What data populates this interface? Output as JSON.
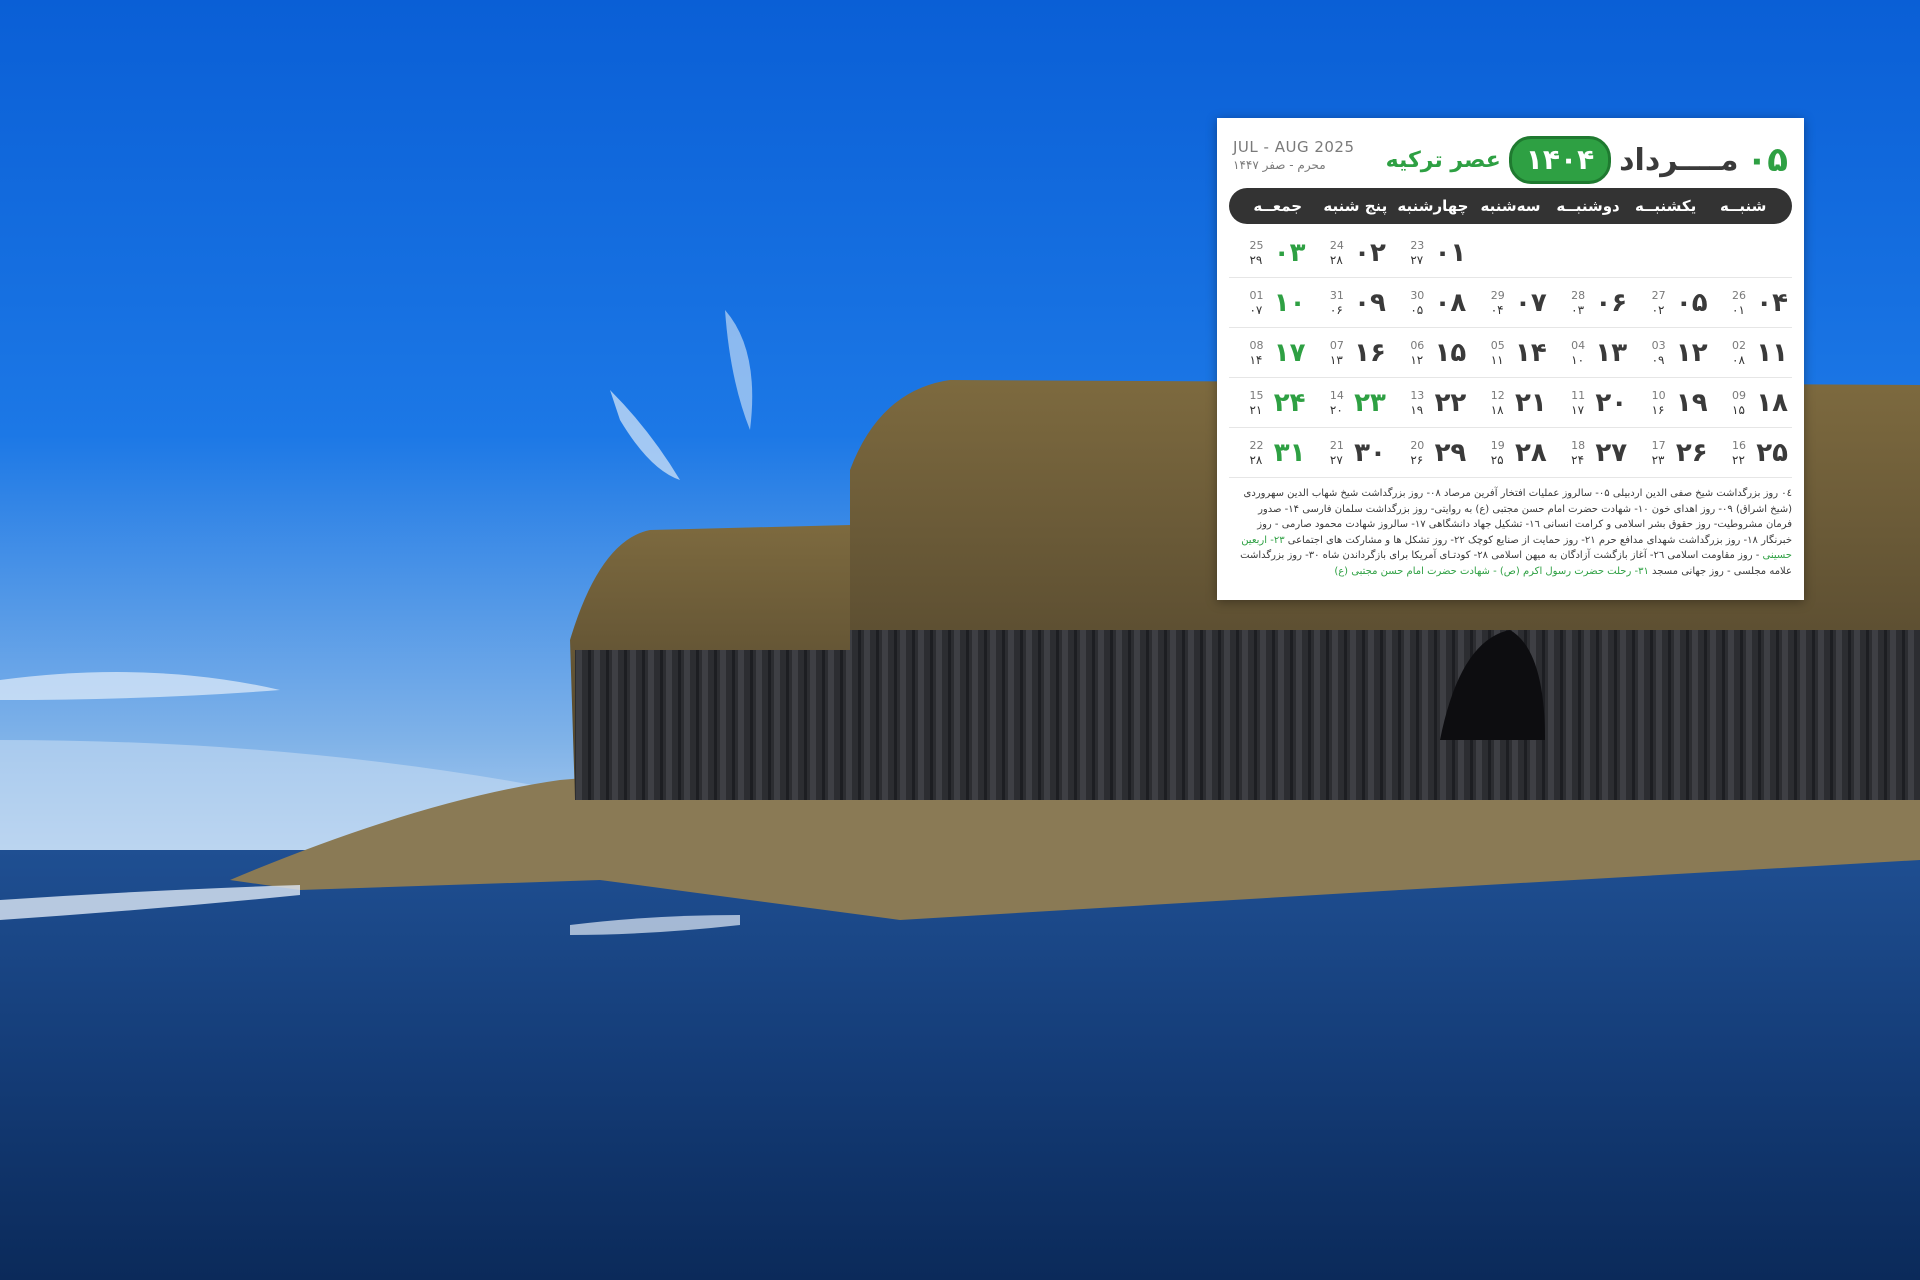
{
  "calendar": {
    "month_number": "۰۵",
    "month_name": "مــــرداد",
    "year": "۱۴۰۴",
    "brand": "عصر ترکیه",
    "gregorian_range": "JUL - AUG 2025",
    "hijri_range": "محرم - صفر ۱۴۴۷",
    "weekdays": [
      "شنبــه",
      "یکشنبــه",
      "دوشنبــه",
      "سه‌شنبه",
      "چهارشنبه",
      "پنج شنبه",
      "جمعــه"
    ],
    "weeks": [
      [
        {
          "day": "",
          "g": "",
          "h": ""
        },
        {
          "day": "",
          "g": "",
          "h": ""
        },
        {
          "day": "",
          "g": "",
          "h": ""
        },
        {
          "day": "",
          "g": "",
          "h": ""
        },
        {
          "day": "۰۱",
          "g": "23",
          "h": "۲۷"
        },
        {
          "day": "۰۲",
          "g": "24",
          "h": "۲۸"
        },
        {
          "day": "۰۳",
          "g": "25",
          "h": "۲۹"
        }
      ],
      [
        {
          "day": "۰۴",
          "g": "26",
          "h": "۰۱"
        },
        {
          "day": "۰۵",
          "g": "27",
          "h": "۰۲"
        },
        {
          "day": "۰۶",
          "g": "28",
          "h": "۰۳"
        },
        {
          "day": "۰۷",
          "g": "29",
          "h": "۰۴"
        },
        {
          "day": "۰۸",
          "g": "30",
          "h": "۰۵"
        },
        {
          "day": "۰۹",
          "g": "31",
          "h": "۰۶"
        },
        {
          "day": "۱۰",
          "g": "01",
          "h": "۰۷"
        }
      ],
      [
        {
          "day": "۱۱",
          "g": "02",
          "h": "۰۸"
        },
        {
          "day": "۱۲",
          "g": "03",
          "h": "۰۹"
        },
        {
          "day": "۱۳",
          "g": "04",
          "h": "۱۰"
        },
        {
          "day": "۱۴",
          "g": "05",
          "h": "۱۱"
        },
        {
          "day": "۱۵",
          "g": "06",
          "h": "۱۲"
        },
        {
          "day": "۱۶",
          "g": "07",
          "h": "۱۳"
        },
        {
          "day": "۱۷",
          "g": "08",
          "h": "۱۴"
        }
      ],
      [
        {
          "day": "۱۸",
          "g": "09",
          "h": "۱۵"
        },
        {
          "day": "۱۹",
          "g": "10",
          "h": "۱۶"
        },
        {
          "day": "۲۰",
          "g": "11",
          "h": "۱۷"
        },
        {
          "day": "۲۱",
          "g": "12",
          "h": "۱۸"
        },
        {
          "day": "۲۲",
          "g": "13",
          "h": "۱۹"
        },
        {
          "day": "۲۳",
          "g": "14",
          "h": "۲۰",
          "holiday": true
        },
        {
          "day": "۲۴",
          "g": "15",
          "h": "۲۱"
        }
      ],
      [
        {
          "day": "۲۵",
          "g": "16",
          "h": "۲۲"
        },
        {
          "day": "۲۶",
          "g": "17",
          "h": "۲۳"
        },
        {
          "day": "۲۷",
          "g": "18",
          "h": "۲۴"
        },
        {
          "day": "۲۸",
          "g": "19",
          "h": "۲۵"
        },
        {
          "day": "۲۹",
          "g": "20",
          "h": "۲۶"
        },
        {
          "day": "۳۰",
          "g": "21",
          "h": "۲۷"
        },
        {
          "day": "۳۱",
          "g": "22",
          "h": "۲۸"
        }
      ]
    ],
    "notes": [
      {
        "text": "۰٤ روز بزرگداشت شیخ صفی الدین اردبیلی ۰۵- سالروز عملیات افتخار آفرین مرصاد ۰۸- روز بزرگداشت شیخ شهاب الدین سهروردی (شیخ اشراق) ۰۹- روز اهدای خون ۱۰- شهادت حضرت امام حسن مجتبی (ع) به روایتی- روز بزرگداشت سلمان فارسی ۱۴- صدور فرمان مشروطیت- روز حقوق بشر اسلامی و کرامت انسانی ۱٦- تشکیل جهاد دانشگاهی ۱۷- سالروز شهادت محمود صارمی - روز خبرنگار ۱۸- روز بزرگداشت شهدای مدافع حرم ۲۱- روز حمایت از صنایع کوچک ۲۲- روز تشکل ها و مشارکت های اجتماعی ",
        "green": false
      },
      {
        "text": "۲۳- اربعین حسینی",
        "green": true
      },
      {
        "text": " - روز مقاومت اسلامی ۲٦- آغاز بازگشت آزادگان به میهن اسلامی ۲۸- کودتـای آمریکا برای بازگرداندن شاه ۳۰- روز بزرگداشت علامه مجلسی - روز جهانی مسجد ",
        "green": false
      },
      {
        "text": "۳۱- رحلت حضرت رسول اکرم (ص) - شهادت حضرت امام حسن مجتبی (ع)",
        "green": true
      }
    ]
  }
}
